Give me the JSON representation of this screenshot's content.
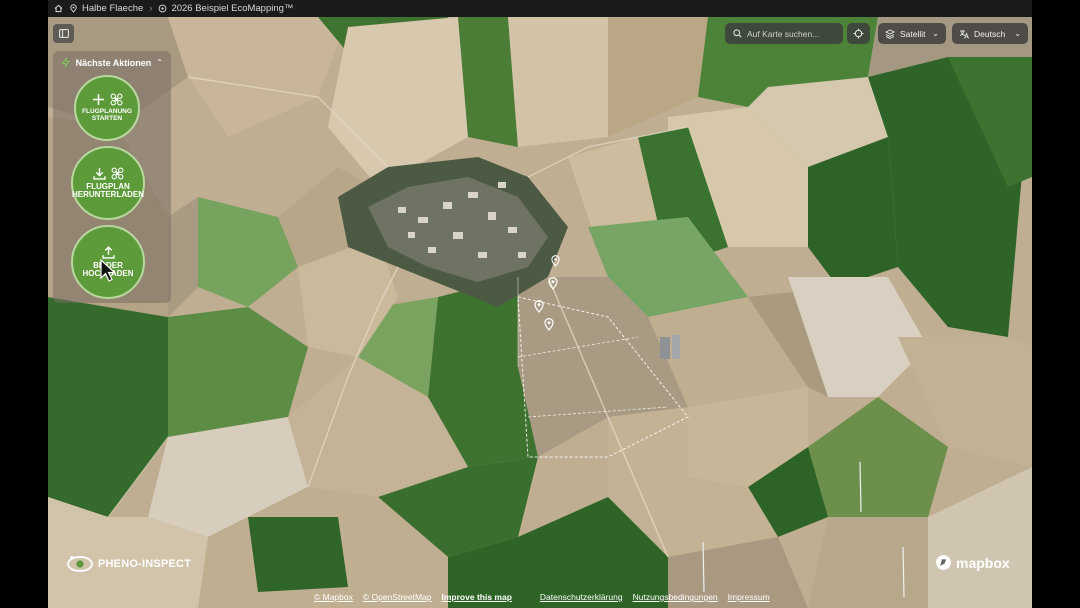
{
  "breadcrumb": {
    "items": [
      {
        "label": "",
        "icon": "home-icon"
      },
      {
        "label": "Halbe Flaeche",
        "icon": "map-pin-icon"
      },
      {
        "label": "2026 Beispiel EcoMapping™",
        "icon": "drone-icon"
      }
    ]
  },
  "panel": {
    "title": "Nächste Aktionen",
    "actions": [
      {
        "line1": "FLUGPLANUNG",
        "line2": "STARTEN",
        "icon": "plus-drone-icon"
      },
      {
        "line1": "FLUGPLAN",
        "line2": "HERUNTERLADEN",
        "icon": "download-drone-icon"
      },
      {
        "line1": "BILDER",
        "line2": "HOCHLADEN",
        "icon": "upload-icon"
      }
    ]
  },
  "search": {
    "placeholder": "Auf Karte suchen..."
  },
  "map_style": {
    "selected": "Satellit"
  },
  "language": {
    "selected": "Deutsch"
  },
  "brand": {
    "name": "PHENO-INSPECT"
  },
  "mapbox_logo": "mapbox",
  "attribution": {
    "mapbox": "© Mapbox",
    "osm": "© OpenStreetMap",
    "improve": "Improve this map",
    "privacy": "Datenschutzerklärung",
    "terms": "Nutzungsbedingungen",
    "imprint": "Impressum"
  },
  "colors": {
    "accent_green": "#5d9a3a",
    "topbar": "#1b1b1d"
  }
}
